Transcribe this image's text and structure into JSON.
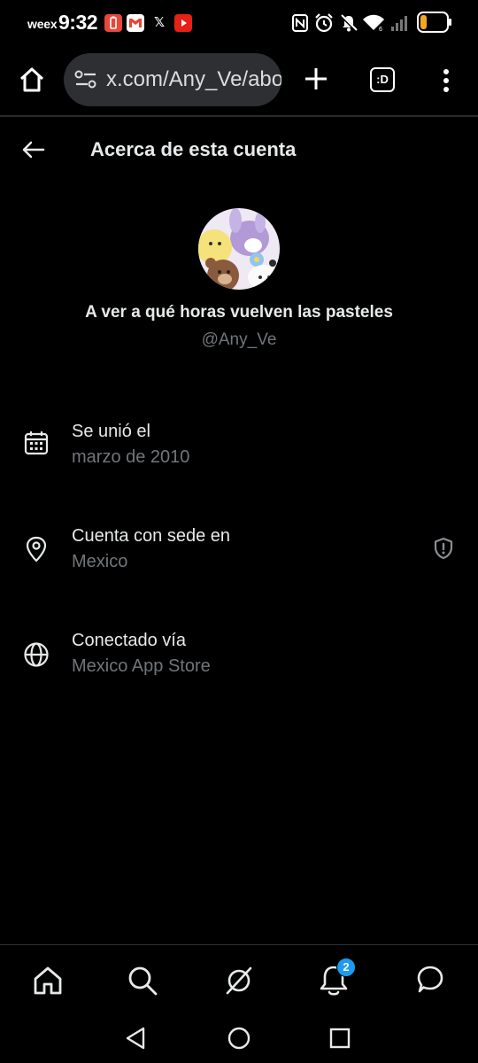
{
  "status_bar": {
    "carrier": "weex",
    "time": "9:32",
    "app_icons": [
      "battery-saver-icon",
      "gmail-icon",
      "x-icon",
      "youtube-icon"
    ],
    "right_icons": [
      "nfc-icon",
      "alarm-icon",
      "mute-icon",
      "wifi-icon",
      "signal-icon",
      "battery-icon"
    ],
    "x_glyph": "𝕏"
  },
  "browser": {
    "url": "x.com/Any_Ve/about",
    "tab_label": ":D"
  },
  "header": {
    "title": "Acerca de esta cuenta"
  },
  "profile": {
    "display_name": "A ver a qué horas vuelven las pasteles",
    "handle": "@Any_Ve"
  },
  "info": [
    {
      "label": "Se unió el",
      "value": "marzo de 2010",
      "icon": "calendar-icon"
    },
    {
      "label": "Cuenta con sede en",
      "value": "Mexico",
      "icon": "location-pin-icon",
      "badge_icon": "shield-icon"
    },
    {
      "label": "Conectado vía",
      "value": "Mexico App Store",
      "icon": "globe-icon"
    }
  ],
  "bottom_nav": {
    "items": [
      "home-icon",
      "search-icon",
      "grok-icon",
      "notifications-icon",
      "messages-icon"
    ],
    "notification_count": "2"
  },
  "colors": {
    "background": "#000000",
    "primary_text": "#e7e9ea",
    "secondary_text": "#71767b",
    "accent": "#1d9bf0",
    "url_bar": "#2d2f33"
  }
}
